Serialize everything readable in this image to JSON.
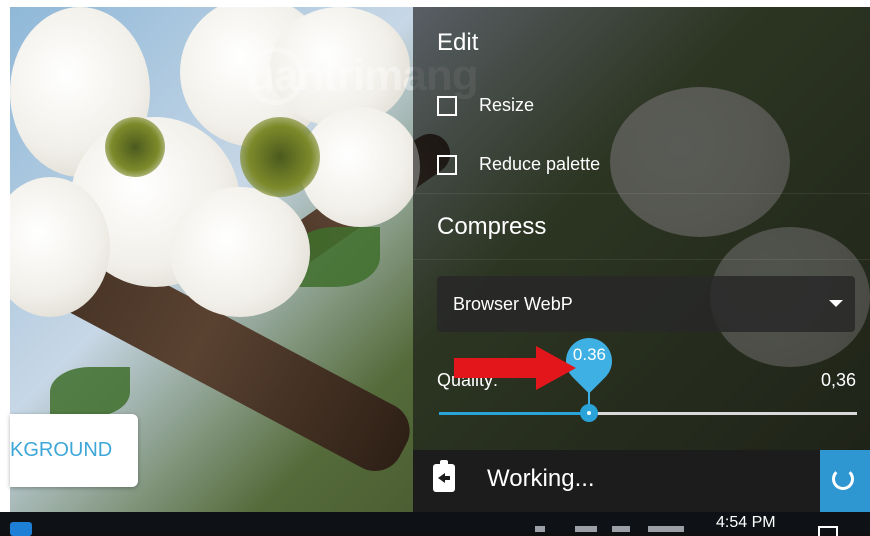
{
  "background_button": {
    "label": "KGROUND"
  },
  "watermark": {
    "text": "uantrimang"
  },
  "panel": {
    "edit": {
      "title": "Edit",
      "options": [
        {
          "label": "Resize",
          "checked": false
        },
        {
          "label": "Reduce palette",
          "checked": false
        }
      ]
    },
    "compress": {
      "title": "Compress",
      "method": {
        "selected": "Browser WebP"
      },
      "quality": {
        "label": "Quality:",
        "value_text": "0,36",
        "bubble_text": "0.36",
        "value": 0.36
      }
    },
    "status": {
      "text": "Working..."
    }
  },
  "taskbar": {
    "time": "4:54 PM"
  },
  "colors": {
    "accent": "#2aa4d8",
    "arrow": "#e3171b"
  }
}
